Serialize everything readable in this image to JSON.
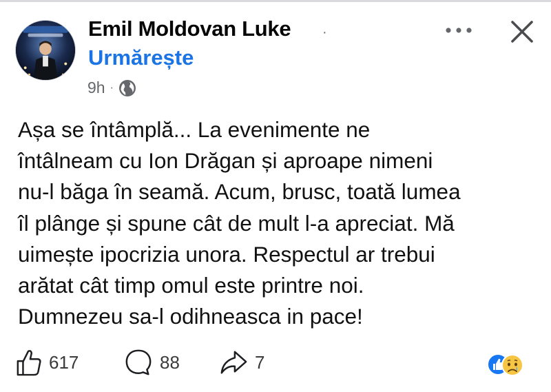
{
  "post": {
    "author": "Emil Moldovan Luke",
    "name_dot": "·",
    "follow_label": "Urmărește",
    "time": "9h",
    "separator": "·",
    "privacy_icon": "globe-icon",
    "text_lines": [
      "Așa se întâmplă... La evenimente ne",
      "întâlneam cu Ion Drăgan și aproape nimeni",
      "nu-l băga în seamă. Acum, brusc, toată lumea",
      "îl plânge și spune cât de mult l-a apreciat. Mă",
      "uimește ipocrizia unora. Respectul ar trebui",
      "arătat cât timp omul este printre noi.",
      "Dumnezeu sa-l odihneasca in pace!"
    ]
  },
  "header_controls": {
    "more_icon": "more-horizontal-icon",
    "close_icon": "close-icon"
  },
  "actions": {
    "likes": "617",
    "comments": "88",
    "shares": "7"
  },
  "reactions": [
    "like-reaction-icon",
    "sad-reaction-icon"
  ],
  "colors": {
    "link_blue": "#1b74e4",
    "text": "#050505",
    "meta_gray": "#65676b",
    "like_blue": "#1877f2",
    "sad_yellow": "#f7c544"
  }
}
